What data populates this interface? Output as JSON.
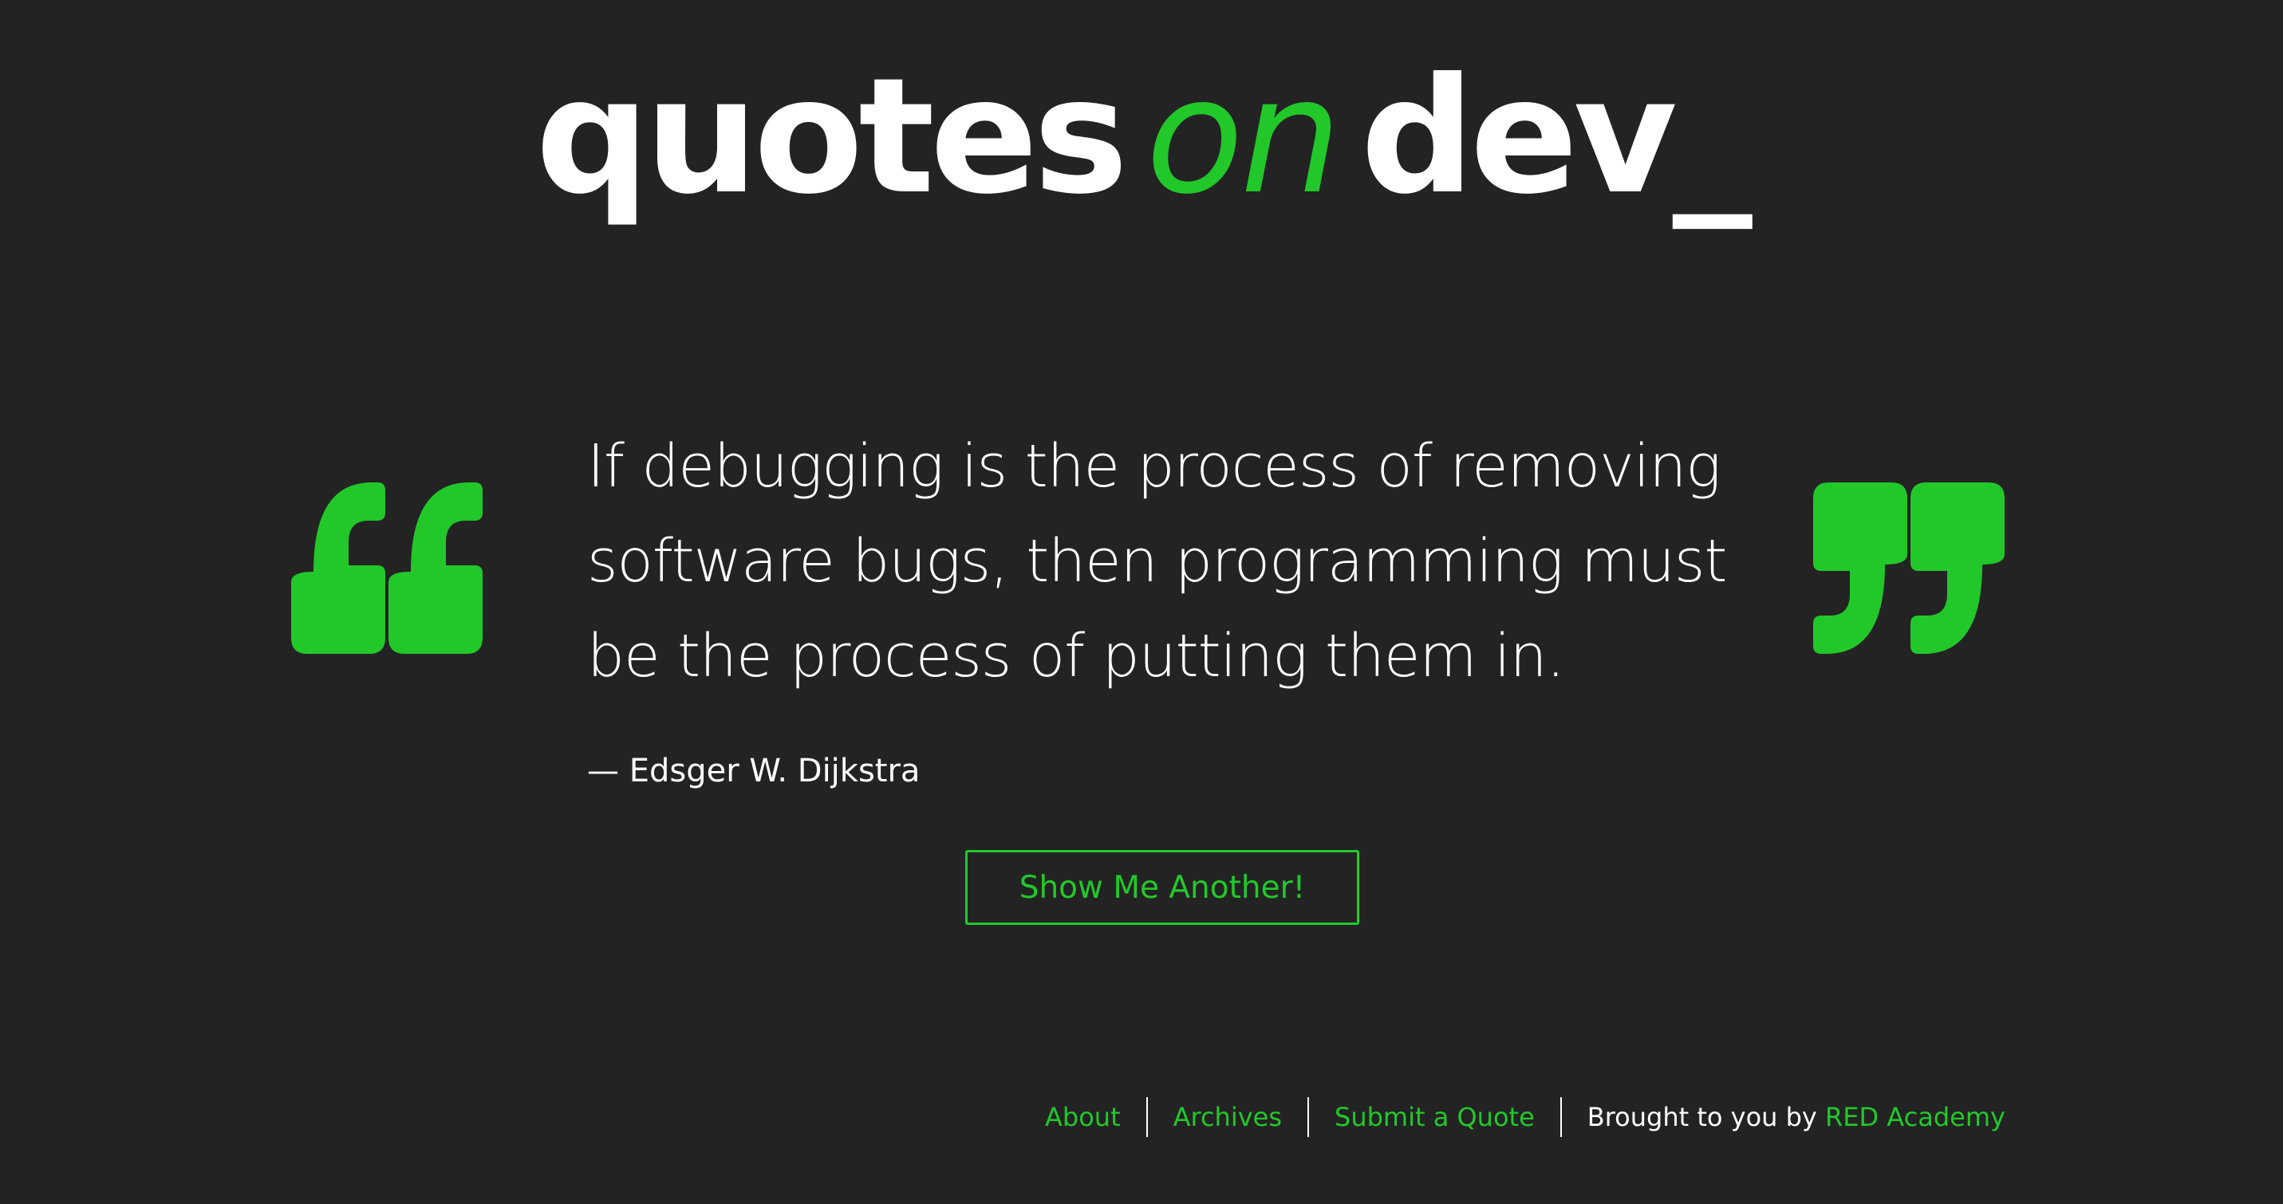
{
  "logo": {
    "word1": "quotes",
    "word2": "on",
    "word3": "dev_"
  },
  "quote": {
    "text": "If debugging is the process of removing software bugs, then programming must be the process of putting them in.",
    "author": "— Edsger W. Dijkstra"
  },
  "button": {
    "label": "Show Me Another!"
  },
  "footer": {
    "links": {
      "about": "About",
      "archives": "Archives",
      "submit": "Submit a Quote"
    },
    "credit_prefix": "Brought to you by",
    "credit_link": "RED Academy"
  },
  "icons": {
    "open_quote": "open-quote-icon",
    "close_quote": "close-quote-icon"
  },
  "colors": {
    "background": "#232323",
    "accent": "#22c82a",
    "text": "#ffffff"
  }
}
